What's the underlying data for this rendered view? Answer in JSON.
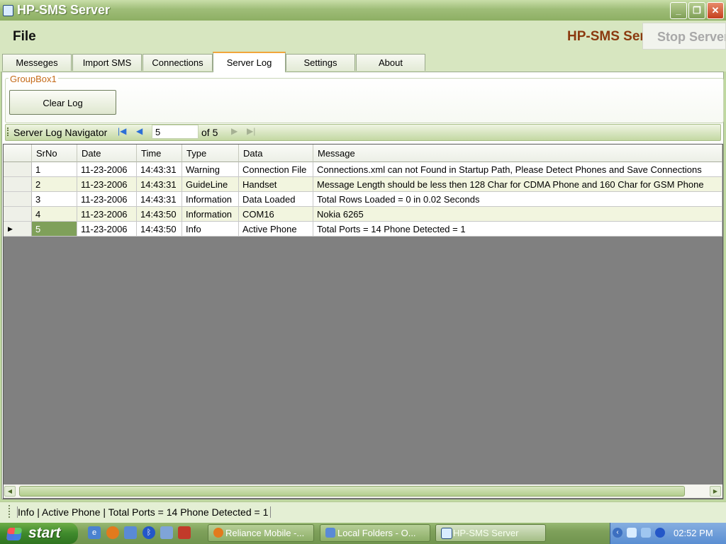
{
  "window": {
    "title": "HP-SMS Server",
    "min_icon": "minimize-icon",
    "max_icon": "maximize-icon",
    "close_icon": "close-icon"
  },
  "menu": {
    "file": "File",
    "brand": "HP-SMS Server",
    "stop_button": "Stop Server"
  },
  "tabs": [
    {
      "label": "Messeges"
    },
    {
      "label": "Import SMS"
    },
    {
      "label": "Connections"
    },
    {
      "label": "Server Log",
      "active": true
    },
    {
      "label": "Settings"
    },
    {
      "label": "About"
    }
  ],
  "groupbox": {
    "label": "GroupBox1",
    "clear_button": "Clear Log"
  },
  "navigator": {
    "label": "Server Log Navigator",
    "position": "5",
    "of_label": "of 5"
  },
  "grid": {
    "columns": [
      "SrNo",
      "Date",
      "Time",
      "Type",
      "Data",
      "Message"
    ],
    "rows": [
      [
        "1",
        "11-23-2006",
        "14:43:31",
        "Warning",
        "Connection File",
        "Connections.xml can not Found in Startup Path, Please Detect Phones and Save Connections"
      ],
      [
        "2",
        "11-23-2006",
        "14:43:31",
        "GuideLine",
        "Handset",
        "Message Length should be less then 128 Char for CDMA Phone and 160 Char for GSM Phone"
      ],
      [
        "3",
        "11-23-2006",
        "14:43:31",
        "Information",
        "Data Loaded",
        "Total Rows Loaded = 0  in  0.02 Seconds"
      ],
      [
        "4",
        "11-23-2006",
        "14:43:50",
        "Information",
        "COM16",
        "Nokia 6265"
      ],
      [
        "5",
        "11-23-2006",
        "14:43:50",
        "Info",
        "Active Phone",
        "Total Ports = 14 Phone Detected = 1"
      ]
    ],
    "selected_row": 5,
    "current_row_marker": "▶"
  },
  "status": {
    "text": "Info | Active Phone | Total Ports = 14 Phone Detected = 1"
  },
  "taskbar": {
    "start": "start",
    "tasks": [
      {
        "label": "Reliance Mobile -..."
      },
      {
        "label": "Local Folders - O..."
      },
      {
        "label": "HP-SMS Server",
        "active": true
      }
    ],
    "clock": "02:52 PM"
  },
  "colors": {
    "accent_tab": "#f1a53b",
    "brand_text": "#8b3a0f",
    "groupbox_label": "#c46a17",
    "selected_cell": "#7fa05a",
    "alt_row": "#f2f5df"
  }
}
